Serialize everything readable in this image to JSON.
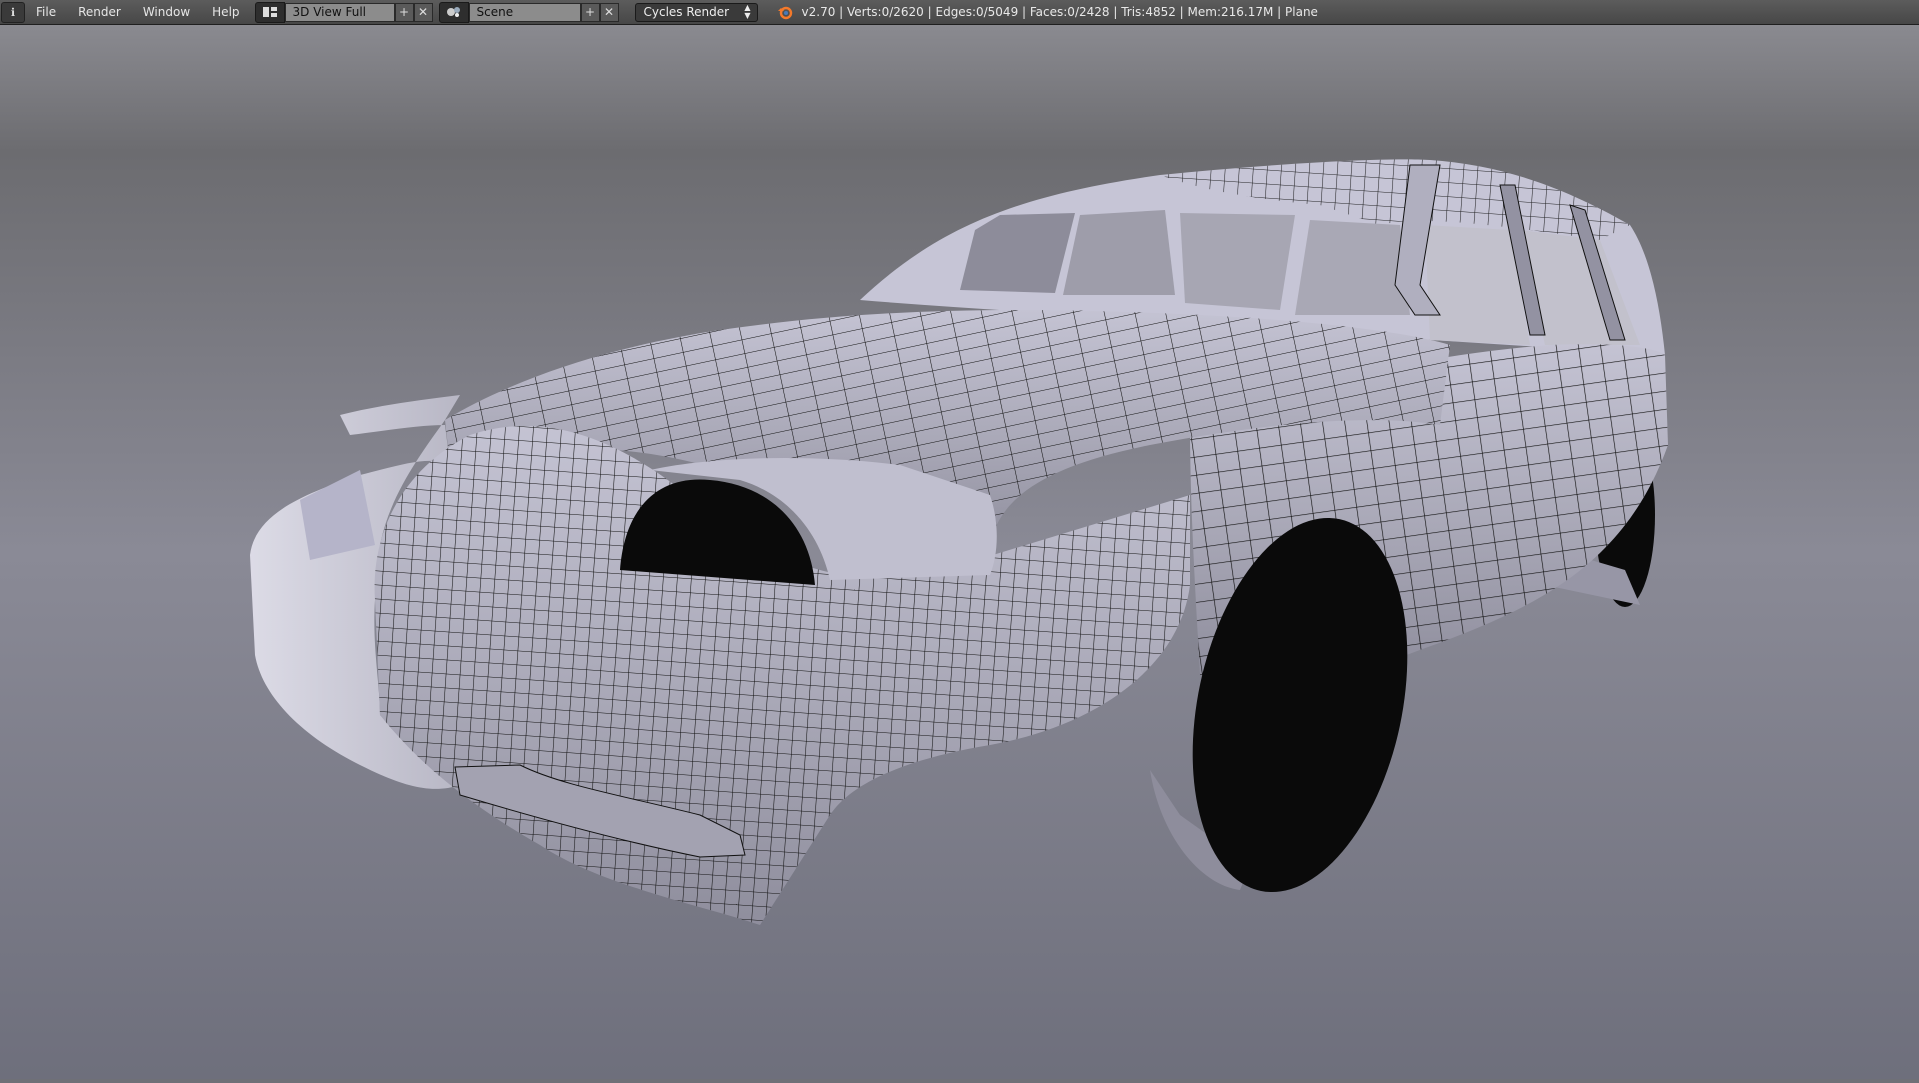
{
  "header": {
    "menus": [
      "File",
      "Render",
      "Window",
      "Help"
    ],
    "layout_name": "3D View Full",
    "scene_name": "Scene",
    "render_engine": "Cycles Render",
    "stats": "v2.70 | Verts:0/2620 | Edges:0/5049 | Faces:0/2428 | Tris:4852 | Mem:216.17M | Plane"
  },
  "icons": {
    "editor_type": "info-icon",
    "layout": "screen-layout-icon",
    "scene": "scene-icon",
    "add": "plus-icon",
    "remove": "x-icon",
    "engine": "blender-logo-icon"
  },
  "colors": {
    "header_bg": "#4f4f4f",
    "viewport_bg": "#6f7077",
    "mesh_solid": "#b9b8c6",
    "wireframe": "#111111"
  }
}
